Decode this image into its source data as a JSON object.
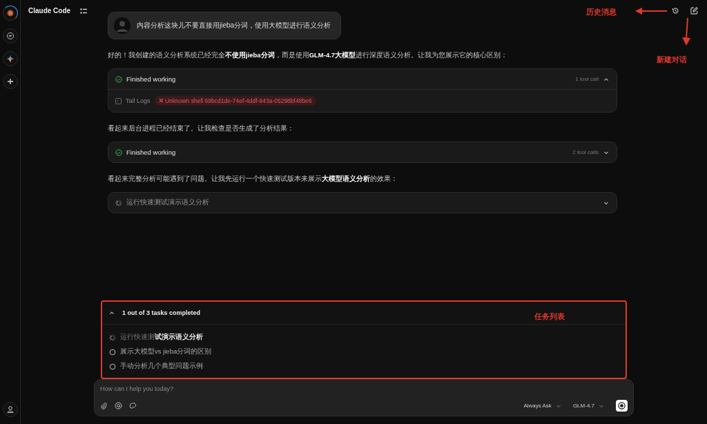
{
  "app_title": "Claude Code",
  "rail": [
    {
      "kind": "logo",
      "selected": true
    },
    {
      "kind": "chat"
    },
    {
      "kind": "sparkle"
    },
    {
      "kind": "plus"
    }
  ],
  "messages": [
    {
      "kind": "user",
      "text": "内容分析这块儿不要直接用jieba分词，使用大模型进行语义分析"
    },
    {
      "kind": "text",
      "text": "好的！我创建的语义分析系统已经完全**不使用jieba分词**，而是使用**GLM-4.7大模型**进行深度语义分析。让我为您展示它的核心区别："
    },
    {
      "kind": "tool",
      "finished": true,
      "title": "Finished working",
      "count": "1 tool call",
      "expanded": true,
      "log_label": "Tail Logs",
      "error": "Unknown shell 69bcd1de-74ef-4ddf-943a-05298bf48be6"
    },
    {
      "kind": "text",
      "text": "看起来后台进程已经结束了。让我检查是否生成了分析结果："
    },
    {
      "kind": "tool",
      "finished": true,
      "title": "Finished working",
      "count": "2 tool calls",
      "expanded": false
    },
    {
      "kind": "text",
      "text": "看起来完整分析可能遇到了问题。让我先运行一个快速测试版本来展示**大模型语义分析**的效果："
    },
    {
      "kind": "tool",
      "finished": false,
      "title": "运行快速测试演示语义分析",
      "expanded": false
    }
  ],
  "tasks": {
    "summary": "1 out of 3 tasks completed",
    "expanded": true,
    "highlighted": true,
    "items": [
      {
        "kind": "running",
        "text": "运行快速测**试演示语义分析**"
      },
      {
        "kind": "pending",
        "text": "展示大模型vs jieba分词的区别"
      },
      {
        "kind": "pending",
        "text": "手动分析几个典型问题示例"
      }
    ]
  },
  "input": {
    "placeholder": "How can I help you today?",
    "mode": "Always Ask",
    "model": "GLM-4.7"
  },
  "annotations": {
    "history": "历史消息",
    "new_chat": "新建对话",
    "task_list": "任务列表"
  }
}
